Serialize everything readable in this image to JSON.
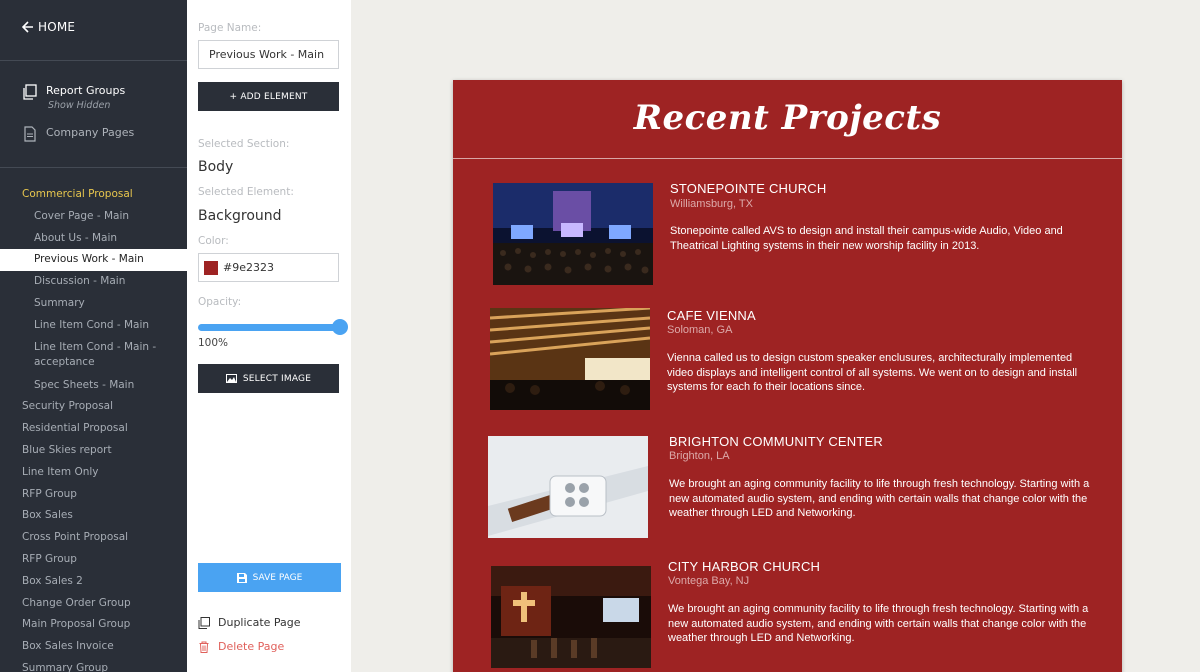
{
  "sidebar": {
    "home_label": "HOME",
    "report_groups_label": "Report Groups",
    "show_hidden_label": "Show Hidden",
    "company_pages_label": "Company Pages",
    "items": [
      {
        "label": "Commercial Proposal"
      },
      {
        "label": "Cover Page - Main"
      },
      {
        "label": "About Us - Main"
      },
      {
        "label": "Previous Work - Main"
      },
      {
        "label": "Discussion - Main"
      },
      {
        "label": "Summary"
      },
      {
        "label": "Line Item Cond - Main"
      },
      {
        "label": "Line Item Cond - Main - acceptance"
      },
      {
        "label": "Spec Sheets - Main"
      },
      {
        "label": "Security Proposal"
      },
      {
        "label": "Residential Proposal"
      },
      {
        "label": "Blue Skies report"
      },
      {
        "label": "Line Item Only"
      },
      {
        "label": "RFP Group"
      },
      {
        "label": "Box Sales"
      },
      {
        "label": "Cross Point Proposal"
      },
      {
        "label": "RFP Group"
      },
      {
        "label": "Box Sales 2"
      },
      {
        "label": "Change Order Group"
      },
      {
        "label": "Main Proposal Group"
      },
      {
        "label": "Box Sales Invoice"
      },
      {
        "label": "Summary Group"
      }
    ]
  },
  "editor": {
    "page_name_label": "Page Name:",
    "page_name_value": "Previous Work - Main",
    "add_element_label": "+ ADD ELEMENT",
    "selected_section_label": "Selected Section:",
    "selected_section_value": "Body",
    "selected_element_label": "Selected Element:",
    "selected_element_value": "Background",
    "color_label": "Color:",
    "color_value": "#9e2323",
    "opacity_label": "Opacity:",
    "opacity_value": "100%",
    "opacity_fraction": 1.0,
    "select_image_label": "SELECT IMAGE",
    "save_page_label": "SAVE PAGE",
    "duplicate_page_label": "Duplicate Page",
    "delete_page_label": "Delete Page"
  },
  "preview": {
    "title": "Recent Projects",
    "background_color": "#9e2323",
    "projects": [
      {
        "name": "STONEPOINTE CHURCH",
        "location": "Williamsburg, TX",
        "description": "Stonepointe called AVS to design and install their campus-wide Audio, Video and Theatrical Lighting systems in their new worship facility in 2013."
      },
      {
        "name": "CAFE VIENNA",
        "location": "Soloman, GA",
        "description": "Vienna called us to design custom speaker enclusures, architecturally implemented video displays and intelligent control of all systems. We went on to design and install systems for each fo their locations since."
      },
      {
        "name": "BRIGHTON COMMUNITY CENTER",
        "location": "Brighton, LA",
        "description": "We brought an aging community facility to life through fresh technology. Starting with a new automated audio system, and ending with certain walls that change color with the weather through LED and Networking."
      },
      {
        "name": "CITY HARBOR CHURCH",
        "location": "Vontega Bay, NJ",
        "description": "We brought an aging community facility to life through fresh technology. Starting with a new automated audio system, and ending with certain walls that change color with the weather through LED and Networking."
      }
    ]
  },
  "colors": {
    "sidebar_bg": "#2a2f38",
    "accent_blue": "#4aa3f2",
    "active_group": "#e7c64e",
    "delete_red": "#e0605b"
  }
}
